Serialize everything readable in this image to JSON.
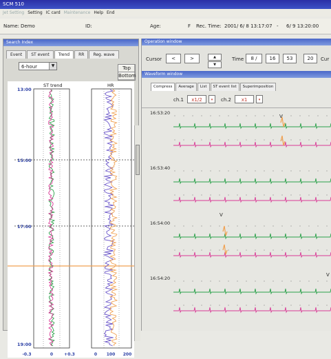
{
  "app": {
    "title": "SCM 510"
  },
  "menu": [
    "Jet Setting",
    "Setting",
    "IC card",
    "Maintenance",
    "Help",
    "End"
  ],
  "menu_disabled": [
    true,
    false,
    false,
    true,
    false,
    false
  ],
  "patient": {
    "name_label": "Name:",
    "name_value": "Demo",
    "id_label": "ID:",
    "age_label": "Age:",
    "sex": "F",
    "rec_time_label": "Rec. Time:",
    "rec_start": "2001/ 6/ 8 13:17:07",
    "dash": "-",
    "rec_end": "6/ 9 13:20:00"
  },
  "search_index": {
    "title": "Search Index",
    "tabs": [
      "Event",
      "ST event",
      "Trend",
      "RR",
      "Reg. wave"
    ],
    "selected_tab": "Trend",
    "range": "6-hour",
    "top_button": "Top",
    "bottom_button": "Bottom",
    "chart_titles": {
      "st": "ST trend",
      "hr": "HR"
    },
    "time_labels": [
      "13:00",
      "15:00",
      "17:00",
      "19:00"
    ],
    "st_axis": [
      "-0.3",
      "0",
      "+0.3"
    ],
    "hr_axis": [
      "0",
      "100",
      "200"
    ]
  },
  "operation": {
    "title": "Operation window",
    "cursor_label": "Cursor",
    "left_arrow": "<",
    "right_arrow": ">",
    "time_label": "Time",
    "time_day": "8 /",
    "time_h": "16",
    "time_m": "53",
    "time_s": "20",
    "cursor2_label": "Cur"
  },
  "waveform": {
    "title": "Waveform window",
    "tabs": [
      "Compress",
      "Average",
      "List",
      "ST event list",
      "Superimposition"
    ],
    "ch1_label": "ch.1",
    "ch1_gain": "x1/2",
    "ch2_label": "ch.2",
    "ch2_gain": "x1",
    "times": [
      "16:53:20",
      "16:53:40",
      "16:54:00",
      "16:54:20"
    ],
    "marker": "V"
  },
  "colors": {
    "ch1": "#2aa049",
    "ch2": "#d93a96",
    "hr": "#6a55c9",
    "cursor": "#f0a050",
    "title": "#2b2fa6"
  }
}
